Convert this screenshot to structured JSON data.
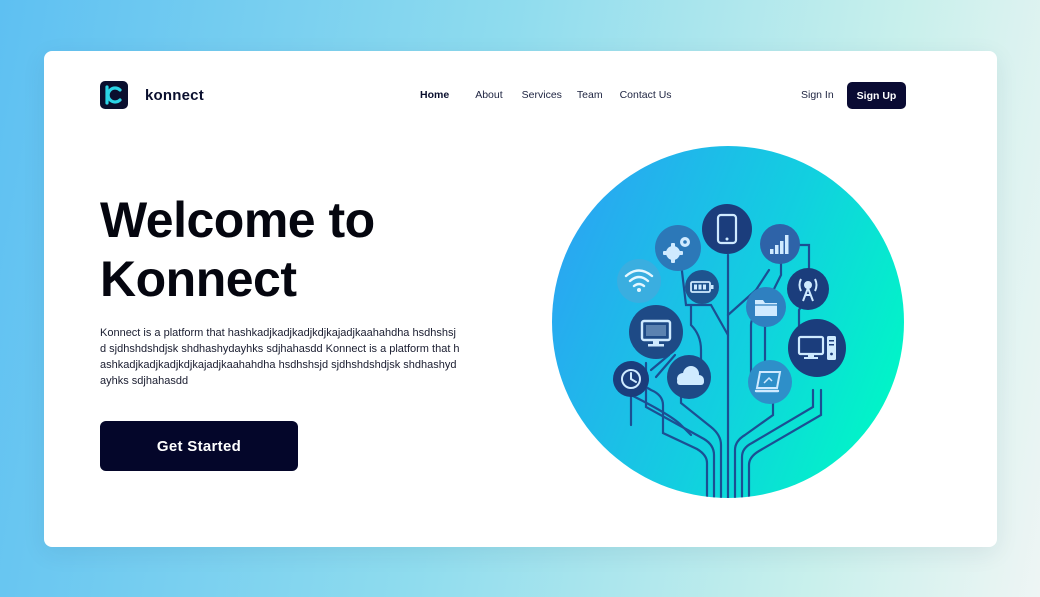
{
  "brand": {
    "name": "konnect",
    "logo_letter": "C"
  },
  "nav": {
    "items": [
      {
        "label": "Home",
        "active": true
      },
      {
        "label": "About"
      },
      {
        "label": "Services"
      },
      {
        "label": "Team"
      },
      {
        "label": "Contact Us"
      }
    ]
  },
  "auth": {
    "signin_label": "Sign In",
    "signup_label": "Sign Up"
  },
  "hero": {
    "title_line1": "Welcome to",
    "title_line2": "Konnect",
    "description": "Konnect is a platform that hashkadjkadjkadjkdjkajadjkaahahdha hsdhshsjd sjdhshdshdjsk shdhashydayhks sdjhahasdd Konnect is a platform that hashkadjkadjkadjkdjkajadjkaahahdha hsdhshsjd sjdhshdshdjsk shdhashydayhks sdjhahasdd",
    "cta_label": "Get Started"
  },
  "colors": {
    "primary": "#0a0b33",
    "circle_gradient_start": "#2aa8f0",
    "circle_gradient_end": "#00f5c8",
    "node_dark": "#1a3a7a"
  },
  "illustration": {
    "icons": [
      "phone-icon",
      "gear-icon",
      "signal-bars-icon",
      "wifi-icon",
      "battery-icon",
      "antenna-icon",
      "folder-icon",
      "monitor-icon",
      "desktop-computer-icon",
      "clock-icon",
      "cloud-icon",
      "laptop-icon"
    ]
  }
}
